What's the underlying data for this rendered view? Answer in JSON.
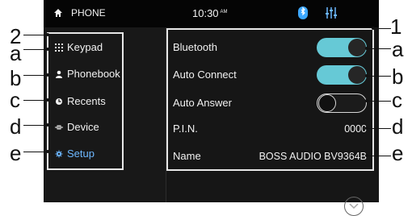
{
  "status": {
    "home_label": "PHONE",
    "time": "10:30",
    "time_suffix": "AM"
  },
  "sidebar": {
    "items": [
      {
        "label": "Keypad"
      },
      {
        "label": "Phonebook"
      },
      {
        "label": "Recents"
      },
      {
        "label": "Device"
      },
      {
        "label": "Setup"
      }
    ]
  },
  "settings": {
    "rows": [
      {
        "label": "Bluetooth",
        "state": "on"
      },
      {
        "label": "Auto Connect",
        "state": "on"
      },
      {
        "label": "Auto Answer",
        "state": "off"
      },
      {
        "label": "P.I.N.",
        "value": "0000"
      },
      {
        "label": "Name",
        "value": "BOSS AUDIO BV9364B"
      }
    ]
  },
  "callouts": {
    "left_number": "2",
    "right_number": "1",
    "letters": [
      "a",
      "b",
      "c",
      "d",
      "e"
    ]
  },
  "colors": {
    "active_blue": "#6db8ff",
    "toggle_on": "#66c9d6",
    "screen_bg": "#161616"
  }
}
